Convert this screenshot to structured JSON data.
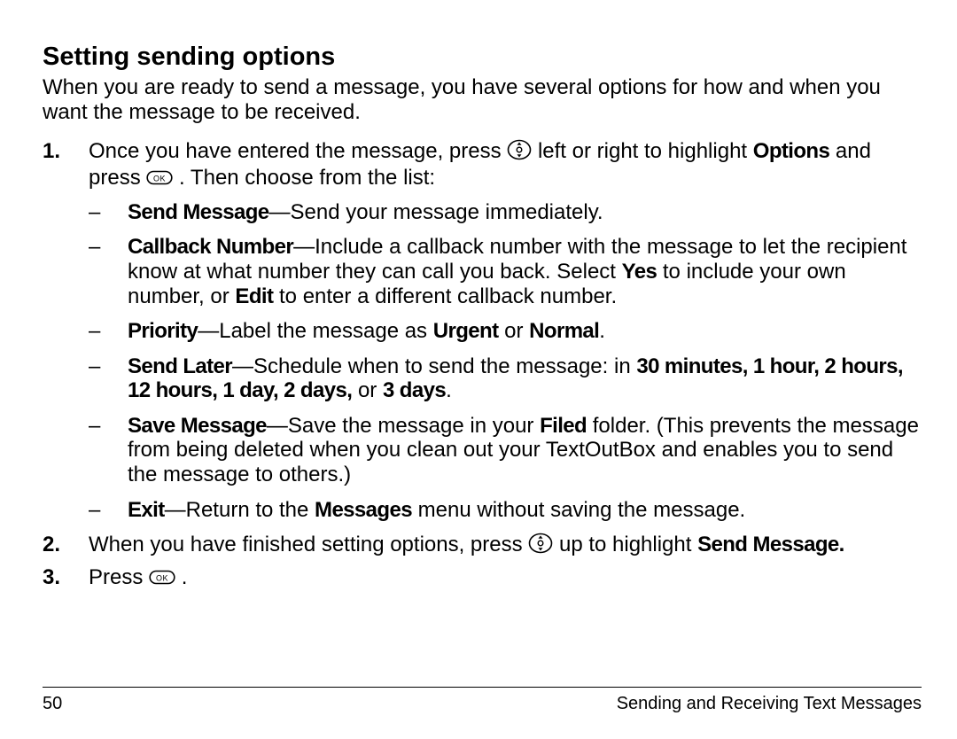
{
  "heading": "Setting sending options",
  "intro": "When you are ready to send a message, you have several options for how and when you want the message to be received.",
  "step1": {
    "num": "1.",
    "t0": "Once you have entered the message, press ",
    "t1": " left or right to highlight ",
    "opt": "Options",
    "t2": " and press ",
    "t3": ". Then choose from the list:"
  },
  "bul": {
    "a_b": "Send Message",
    "a_t": "—Send your message immediately.",
    "b_b": "Callback Number",
    "b_t0": "—Include a callback number with the message to let the recipient know at what number they can call you back. Select ",
    "b_yes": "Yes",
    "b_t1": " to include your own number, or ",
    "b_edit": "Edit",
    "b_t2": " to enter a different callback number.",
    "c_b": "Priority",
    "c_t0": "—Label the message as ",
    "c_u": "Urgent",
    "c_t1": " or ",
    "c_n": "Normal",
    "c_t2": ".",
    "d_b": "Send Later",
    "d_t0": "—Schedule when to send the message: in ",
    "d_30": "30 minutes, 1 hour, 2 hours, 12 hours, 1 day, 2 days,",
    "d_t1": " or ",
    "d_3": "3 days",
    "d_t2": ".",
    "e_b": "Save Message",
    "e_t0": "—Save the message in your ",
    "e_filed": "Filed",
    "e_t1": " folder. (This prevents the message from being deleted when you clean out your TextOutBox and enables you to send the message to others.)",
    "f_b": "Exit",
    "f_t0": "—Return to the ",
    "f_m": "Messages",
    "f_t1": " menu without saving the message."
  },
  "step2": {
    "num": "2.",
    "t0": "When you have finished setting options, press ",
    "t1": " up to highlight ",
    "sm": "Send Message."
  },
  "step3": {
    "num": "3.",
    "t0": "Press ",
    "t1": "."
  },
  "footer": {
    "page": "50",
    "chapter": "Sending and Receiving Text Messages"
  },
  "dash": "–"
}
